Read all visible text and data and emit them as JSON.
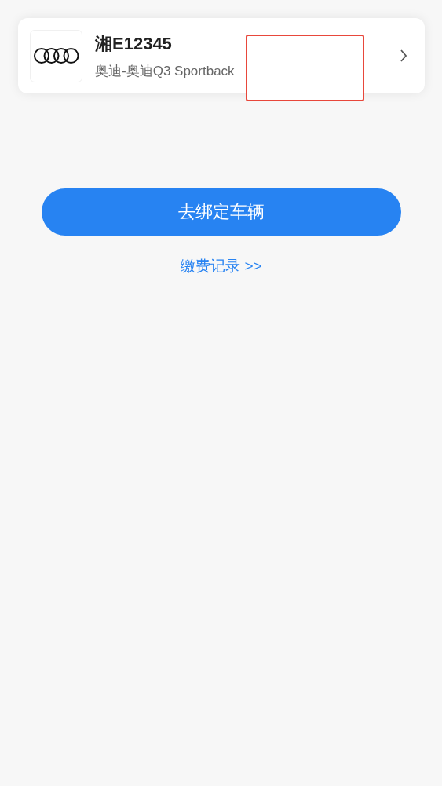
{
  "vehicle": {
    "plate": "湘E12345",
    "model": "奥迪-奥迪Q3 Sportback"
  },
  "bind_button": {
    "label": "去绑定车辆"
  },
  "records_link": {
    "label": "缴费记录 >>"
  }
}
